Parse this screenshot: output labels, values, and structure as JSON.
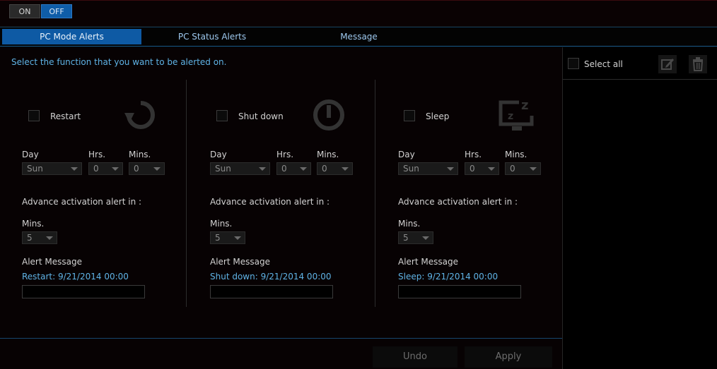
{
  "toggle": {
    "on_label": "ON",
    "off_label": "OFF",
    "selected": "OFF"
  },
  "tabs": [
    {
      "label": "PC Mode Alerts",
      "active": true
    },
    {
      "label": "PC Status Alerts",
      "active": false
    },
    {
      "label": "Message",
      "active": false
    }
  ],
  "instruction": "Select the function that you want to be alerted on.",
  "sections": [
    {
      "label": "Restart",
      "icon": "restart-icon",
      "day_label": "Day",
      "hrs_label": "Hrs.",
      "mins_label": "Mins.",
      "day_value": "Sun",
      "hrs_value": "0",
      "mins_value": "0",
      "advance_label": "Advance activation alert in :",
      "advance_mins_label": "Mins.",
      "advance_mins_value": "5",
      "alert_message_label": "Alert Message",
      "alert_message_text": "Restart: 9/21/2014 00:00",
      "alert_input_value": ""
    },
    {
      "label": "Shut down",
      "icon": "power-icon",
      "day_label": "Day",
      "hrs_label": "Hrs.",
      "mins_label": "Mins.",
      "day_value": "Sun",
      "hrs_value": "0",
      "mins_value": "0",
      "advance_label": "Advance activation alert in :",
      "advance_mins_label": "Mins.",
      "advance_mins_value": "5",
      "alert_message_label": "Alert Message",
      "alert_message_text": "Shut down: 9/21/2014 00:00",
      "alert_input_value": ""
    },
    {
      "label": "Sleep",
      "icon": "sleep-icon",
      "day_label": "Day",
      "hrs_label": "Hrs.",
      "mins_label": "Mins.",
      "day_value": "Sun",
      "hrs_value": "0",
      "mins_value": "0",
      "advance_label": "Advance activation alert in :",
      "advance_mins_label": "Mins.",
      "advance_mins_value": "5",
      "alert_message_label": "Alert Message",
      "alert_message_text": "Sleep: 9/21/2014 00:00",
      "alert_input_value": ""
    }
  ],
  "buttons": {
    "undo": "Undo",
    "apply": "Apply"
  },
  "right_panel": {
    "select_all_label": "Select all",
    "edit_icon": "edit-icon",
    "delete_icon": "trash-icon"
  },
  "colors": {
    "accent": "#0e5aa4",
    "link_text": "#5fb3e6",
    "background": "#000000"
  }
}
